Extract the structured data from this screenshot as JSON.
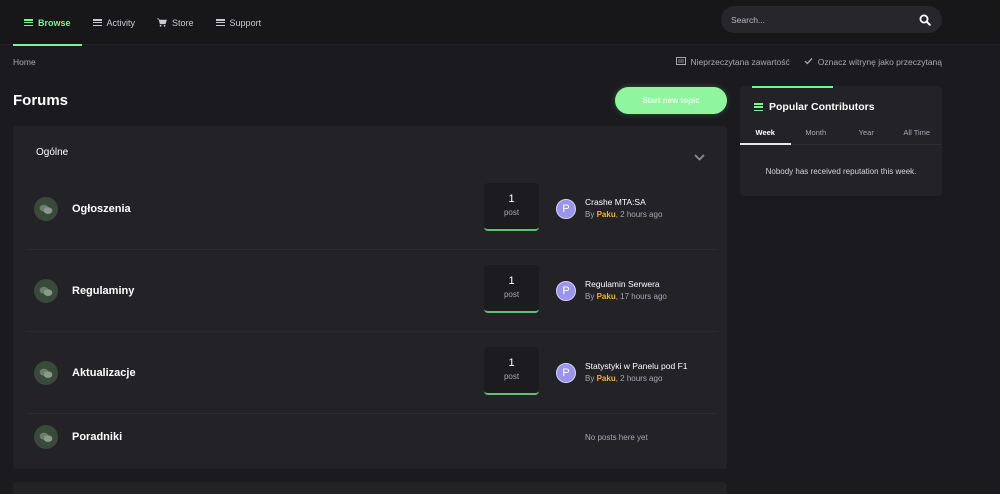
{
  "nav": {
    "items": [
      {
        "label": "Browse",
        "icon": "menu-icon",
        "active": true
      },
      {
        "label": "Activity",
        "icon": "menu-icon"
      },
      {
        "label": "Store",
        "icon": "cart-icon"
      },
      {
        "label": "Support",
        "icon": "menu-icon"
      }
    ]
  },
  "search": {
    "placeholder": "Search..."
  },
  "breadcrumb": {
    "home": "Home"
  },
  "actions": {
    "unread": "Nieprzeczytana zawartość",
    "mark_read": "Oznacz witrynę jako przeczytaną"
  },
  "page": {
    "title": "Forums",
    "start_topic": "Start new topic"
  },
  "category": {
    "name": "Ogólne",
    "forums": [
      {
        "name": "Ogłoszenia",
        "count": "1",
        "count_label": "post",
        "last_title": "Crashe MTA:SA",
        "by": "By",
        "user": "Paku",
        "time": ", 2 hours ago",
        "avatar": "P"
      },
      {
        "name": "Regulaminy",
        "count": "1",
        "count_label": "post",
        "last_title": "Regulamin Serwera",
        "by": "By",
        "user": "Paku",
        "time": ", 17 hours ago",
        "avatar": "P"
      },
      {
        "name": "Aktualizacje",
        "count": "1",
        "count_label": "post",
        "last_title": "Statystyki w Panelu pod F1",
        "by": "By",
        "user": "Paku",
        "time": ", 2 hours ago",
        "avatar": "P"
      },
      {
        "name": "Poradniki",
        "no_posts": "No posts here yet"
      }
    ]
  },
  "widget": {
    "title": "Popular Contributors",
    "tabs": [
      "Week",
      "Month",
      "Year",
      "All Time"
    ],
    "active_tab": "Week",
    "empty": "Nobody has received reputation this week."
  },
  "colors": {
    "accent": "#7cf28e",
    "button": "#8ff59f",
    "username": "#f2b233",
    "avatar": "#9a95ea"
  }
}
